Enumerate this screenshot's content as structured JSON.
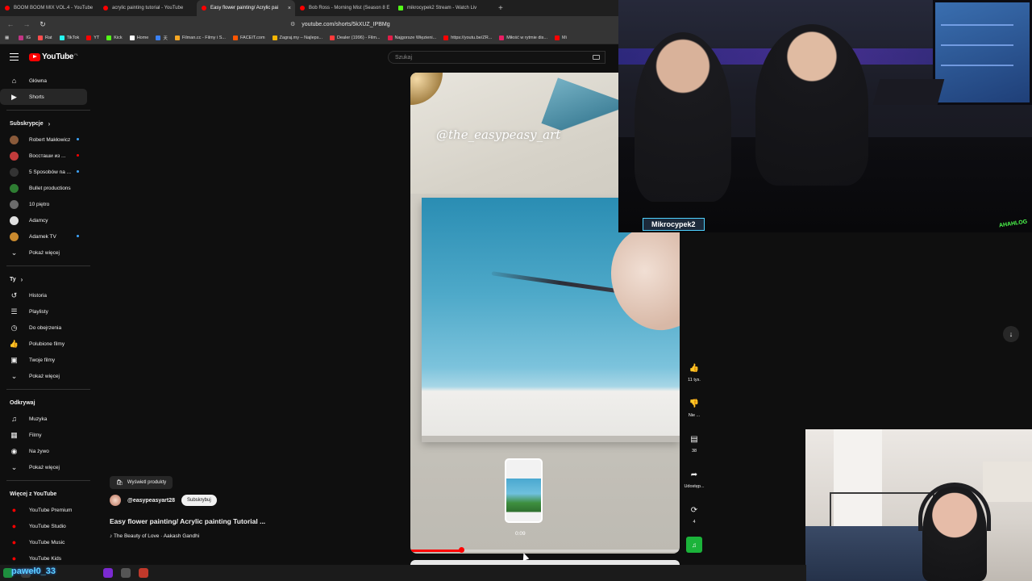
{
  "browser": {
    "tabs": [
      {
        "title": "BOOM BOOM MIX VOL.4 - YouTube",
        "favicon": "youtube-favicon",
        "active": false
      },
      {
        "title": "acrylic painting tutorial - YouTube",
        "favicon": "youtube-favicon",
        "active": false
      },
      {
        "title": "Easy flower painting/ Acrylic pai",
        "favicon": "youtube-favicon",
        "active": true
      },
      {
        "title": "Bob Ross - Morning Mist (Season 8 E",
        "favicon": "youtube-favicon",
        "active": false
      },
      {
        "title": "mikrocypek2 Stream - Watch Liv",
        "favicon": "kick-favicon",
        "active": false
      }
    ],
    "new_tab": "+",
    "url": "youtube.com/shorts/5kXUZ_IPBMg",
    "bookmarks": [
      "IG",
      "Rat",
      "TikTok",
      "YT",
      "Kick",
      "Home",
      "天",
      "Filman.cc - Filmy i S...",
      "FACEIT.com",
      "Zagraj.my – Najleps...",
      "Dealer (1996) - Film...",
      "Najgorsze Więzieni...",
      "https://youtu.be/ZR...",
      "Miłość w rytmie dis...",
      "Mi"
    ]
  },
  "youtube": {
    "logo_text": "YouTube",
    "logo_country": "PL",
    "search_placeholder": "Szukaj",
    "sidebar": {
      "main": [
        {
          "label": "Główna",
          "icon": "home-icon"
        },
        {
          "label": "Shorts",
          "icon": "shorts-icon",
          "active": true
        }
      ],
      "subscriptions_header": "Subskrypcje",
      "subscriptions": [
        {
          "label": "Robert Makłowicz",
          "color": "#8a5a3a",
          "dot": "blue"
        },
        {
          "label": "Воссташи из ...",
          "color": "#c23b3b",
          "dot": "red"
        },
        {
          "label": "5 Sposobów na ...",
          "color": "#333333",
          "dot": "blue"
        },
        {
          "label": "Bullet productions",
          "color": "#2e7d32",
          "dot": ""
        },
        {
          "label": "10 piętro",
          "color": "#6b6b6b",
          "dot": ""
        },
        {
          "label": "Adamcy",
          "color": "#e0e0e0",
          "dot": ""
        },
        {
          "label": "Adamek TV",
          "color": "#c98a2e",
          "dot": "blue"
        }
      ],
      "subscriptions_more": "Pokaż więcej",
      "you_header": "Ty",
      "you": [
        {
          "label": "Historia",
          "icon": "history-icon"
        },
        {
          "label": "Playlisty",
          "icon": "playlist-icon"
        },
        {
          "label": "Do obejrzenia",
          "icon": "watch-later-icon"
        },
        {
          "label": "Polubione filmy",
          "icon": "thumbs-up-icon"
        },
        {
          "label": "Twoje filmy",
          "icon": "your-videos-icon"
        }
      ],
      "you_more": "Pokaż więcej",
      "explore_header": "Odkrywaj",
      "explore": [
        {
          "label": "Muzyka",
          "icon": "music-icon"
        },
        {
          "label": "Filmy",
          "icon": "film-icon"
        },
        {
          "label": "Na żywo",
          "icon": "live-icon"
        }
      ],
      "explore_more": "Pokaż więcej",
      "more_header": "Więcej z YouTube",
      "more": [
        {
          "label": "YouTube Premium",
          "icon": "youtube-premium-icon"
        },
        {
          "label": "YouTube Studio",
          "icon": "youtube-studio-icon"
        },
        {
          "label": "YouTube Music",
          "icon": "youtube-music-icon"
        },
        {
          "label": "YouTube Kids",
          "icon": "youtube-kids-icon"
        }
      ]
    },
    "short": {
      "watermark": "@the_easypeasy_art",
      "products_button": "Wyświetl produkty",
      "channel": "@easypeasyart28",
      "subscribe": "Subskrybuj",
      "title": "Easy flower painting/ Acrylic painting  Tutorial ...",
      "music": "♪ The Beauty of Love · Aakash Gandhi",
      "preview_time": "0:09",
      "progress": 0.19,
      "actions": [
        {
          "icon": "thumbs-up-icon",
          "label": "11 tys."
        },
        {
          "icon": "thumbs-down-icon",
          "label": "Nie ..."
        },
        {
          "icon": "comments-icon",
          "label": "38"
        },
        {
          "icon": "share-icon",
          "label": "Udostęp..."
        },
        {
          "icon": "remix-icon",
          "label": "4"
        }
      ]
    }
  },
  "stream_overlay": {
    "streamer": "Mikrocypek2",
    "logo": "AHAHLOG"
  },
  "taskbar": {
    "username": "paweł0_33"
  }
}
